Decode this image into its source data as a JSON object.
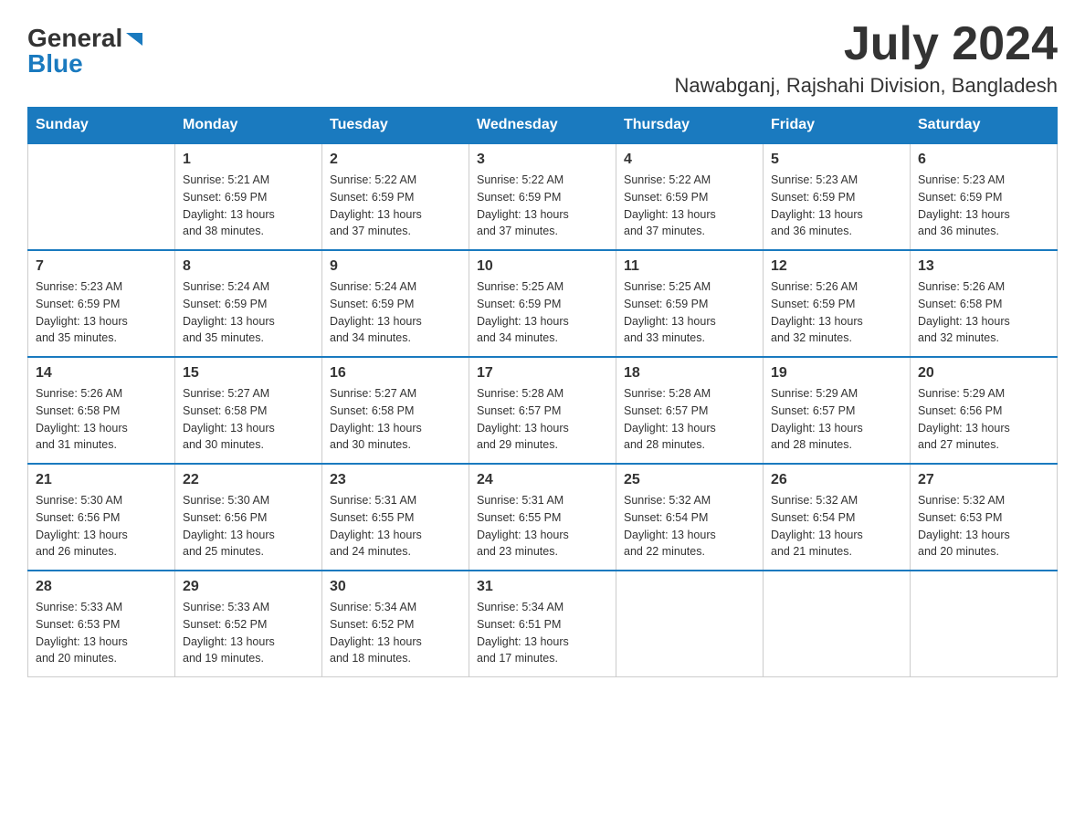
{
  "header": {
    "logo_general": "General",
    "logo_blue": "Blue",
    "month_year": "July 2024",
    "location": "Nawabganj, Rajshahi Division, Bangladesh"
  },
  "weekdays": [
    "Sunday",
    "Monday",
    "Tuesday",
    "Wednesday",
    "Thursday",
    "Friday",
    "Saturday"
  ],
  "weeks": [
    [
      {
        "day": "",
        "info": ""
      },
      {
        "day": "1",
        "info": "Sunrise: 5:21 AM\nSunset: 6:59 PM\nDaylight: 13 hours\nand 38 minutes."
      },
      {
        "day": "2",
        "info": "Sunrise: 5:22 AM\nSunset: 6:59 PM\nDaylight: 13 hours\nand 37 minutes."
      },
      {
        "day": "3",
        "info": "Sunrise: 5:22 AM\nSunset: 6:59 PM\nDaylight: 13 hours\nand 37 minutes."
      },
      {
        "day": "4",
        "info": "Sunrise: 5:22 AM\nSunset: 6:59 PM\nDaylight: 13 hours\nand 37 minutes."
      },
      {
        "day": "5",
        "info": "Sunrise: 5:23 AM\nSunset: 6:59 PM\nDaylight: 13 hours\nand 36 minutes."
      },
      {
        "day": "6",
        "info": "Sunrise: 5:23 AM\nSunset: 6:59 PM\nDaylight: 13 hours\nand 36 minutes."
      }
    ],
    [
      {
        "day": "7",
        "info": "Sunrise: 5:23 AM\nSunset: 6:59 PM\nDaylight: 13 hours\nand 35 minutes."
      },
      {
        "day": "8",
        "info": "Sunrise: 5:24 AM\nSunset: 6:59 PM\nDaylight: 13 hours\nand 35 minutes."
      },
      {
        "day": "9",
        "info": "Sunrise: 5:24 AM\nSunset: 6:59 PM\nDaylight: 13 hours\nand 34 minutes."
      },
      {
        "day": "10",
        "info": "Sunrise: 5:25 AM\nSunset: 6:59 PM\nDaylight: 13 hours\nand 34 minutes."
      },
      {
        "day": "11",
        "info": "Sunrise: 5:25 AM\nSunset: 6:59 PM\nDaylight: 13 hours\nand 33 minutes."
      },
      {
        "day": "12",
        "info": "Sunrise: 5:26 AM\nSunset: 6:59 PM\nDaylight: 13 hours\nand 32 minutes."
      },
      {
        "day": "13",
        "info": "Sunrise: 5:26 AM\nSunset: 6:58 PM\nDaylight: 13 hours\nand 32 minutes."
      }
    ],
    [
      {
        "day": "14",
        "info": "Sunrise: 5:26 AM\nSunset: 6:58 PM\nDaylight: 13 hours\nand 31 minutes."
      },
      {
        "day": "15",
        "info": "Sunrise: 5:27 AM\nSunset: 6:58 PM\nDaylight: 13 hours\nand 30 minutes."
      },
      {
        "day": "16",
        "info": "Sunrise: 5:27 AM\nSunset: 6:58 PM\nDaylight: 13 hours\nand 30 minutes."
      },
      {
        "day": "17",
        "info": "Sunrise: 5:28 AM\nSunset: 6:57 PM\nDaylight: 13 hours\nand 29 minutes."
      },
      {
        "day": "18",
        "info": "Sunrise: 5:28 AM\nSunset: 6:57 PM\nDaylight: 13 hours\nand 28 minutes."
      },
      {
        "day": "19",
        "info": "Sunrise: 5:29 AM\nSunset: 6:57 PM\nDaylight: 13 hours\nand 28 minutes."
      },
      {
        "day": "20",
        "info": "Sunrise: 5:29 AM\nSunset: 6:56 PM\nDaylight: 13 hours\nand 27 minutes."
      }
    ],
    [
      {
        "day": "21",
        "info": "Sunrise: 5:30 AM\nSunset: 6:56 PM\nDaylight: 13 hours\nand 26 minutes."
      },
      {
        "day": "22",
        "info": "Sunrise: 5:30 AM\nSunset: 6:56 PM\nDaylight: 13 hours\nand 25 minutes."
      },
      {
        "day": "23",
        "info": "Sunrise: 5:31 AM\nSunset: 6:55 PM\nDaylight: 13 hours\nand 24 minutes."
      },
      {
        "day": "24",
        "info": "Sunrise: 5:31 AM\nSunset: 6:55 PM\nDaylight: 13 hours\nand 23 minutes."
      },
      {
        "day": "25",
        "info": "Sunrise: 5:32 AM\nSunset: 6:54 PM\nDaylight: 13 hours\nand 22 minutes."
      },
      {
        "day": "26",
        "info": "Sunrise: 5:32 AM\nSunset: 6:54 PM\nDaylight: 13 hours\nand 21 minutes."
      },
      {
        "day": "27",
        "info": "Sunrise: 5:32 AM\nSunset: 6:53 PM\nDaylight: 13 hours\nand 20 minutes."
      }
    ],
    [
      {
        "day": "28",
        "info": "Sunrise: 5:33 AM\nSunset: 6:53 PM\nDaylight: 13 hours\nand 20 minutes."
      },
      {
        "day": "29",
        "info": "Sunrise: 5:33 AM\nSunset: 6:52 PM\nDaylight: 13 hours\nand 19 minutes."
      },
      {
        "day": "30",
        "info": "Sunrise: 5:34 AM\nSunset: 6:52 PM\nDaylight: 13 hours\nand 18 minutes."
      },
      {
        "day": "31",
        "info": "Sunrise: 5:34 AM\nSunset: 6:51 PM\nDaylight: 13 hours\nand 17 minutes."
      },
      {
        "day": "",
        "info": ""
      },
      {
        "day": "",
        "info": ""
      },
      {
        "day": "",
        "info": ""
      }
    ]
  ]
}
